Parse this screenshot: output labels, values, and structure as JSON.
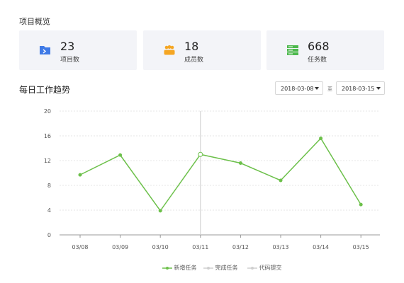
{
  "overview": {
    "title": "项目概览",
    "cards": [
      {
        "value": "23",
        "label": "项目数",
        "icon": "folder-icon",
        "color": "#3f7ae6"
      },
      {
        "value": "18",
        "label": "成员数",
        "icon": "group-icon",
        "color": "#f5a623"
      },
      {
        "value": "668",
        "label": "任务数",
        "icon": "server-icon",
        "color": "#4cb84c"
      }
    ]
  },
  "trend": {
    "title": "每日工作趋势",
    "date_from": "2018-03-08",
    "date_to": "2018-03-15",
    "to_label": "至"
  },
  "chart_data": {
    "type": "line",
    "categories": [
      "03/08",
      "03/09",
      "03/10",
      "03/11",
      "03/12",
      "03/13",
      "03/14",
      "03/15"
    ],
    "series": [
      {
        "name": "新增任务",
        "values": [
          9.7,
          12.9,
          3.9,
          13.0,
          11.6,
          8.8,
          15.6,
          4.9
        ],
        "color": "#6cc04a"
      },
      {
        "name": "完成任务",
        "values": [],
        "color": "#cfcfcf"
      },
      {
        "name": "代码提交",
        "values": [],
        "color": "#cfcfcf"
      }
    ],
    "yticks": [
      0,
      4,
      8,
      12,
      16,
      20
    ],
    "ylim": [
      0,
      20
    ],
    "grid": true,
    "legend_position": "bottom"
  }
}
